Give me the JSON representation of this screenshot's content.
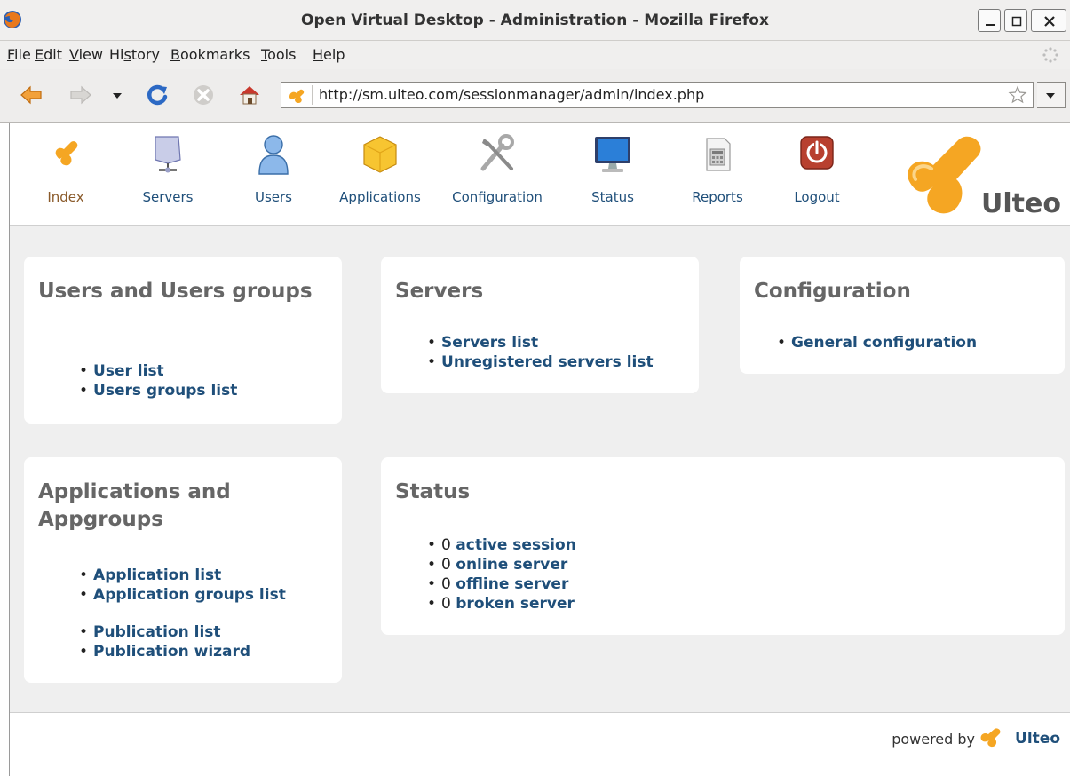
{
  "window": {
    "title": "Open Virtual Desktop - Administration - Mozilla Firefox"
  },
  "menu": {
    "items": [
      {
        "label": "File",
        "u": "F",
        "rest": "ile"
      },
      {
        "label": "Edit",
        "u": "E",
        "rest": "dit"
      },
      {
        "label": "View",
        "u": "V",
        "rest": "iew"
      },
      {
        "label": "History",
        "pre": "Hi",
        "u": "s",
        "rest": "tory"
      },
      {
        "label": "Bookmarks",
        "u": "B",
        "rest": "ookmarks"
      },
      {
        "label": "Tools",
        "u": "T",
        "rest": "ools"
      },
      {
        "label": "Help",
        "u": "H",
        "rest": "elp"
      }
    ]
  },
  "toolbar": {
    "url": "http://sm.ulteo.com/sessionmanager/admin/index.php"
  },
  "nav": {
    "items": [
      {
        "label": "Index",
        "icon": "ulteo-index-icon"
      },
      {
        "label": "Servers",
        "icon": "servers-icon"
      },
      {
        "label": "Users",
        "icon": "users-icon"
      },
      {
        "label": "Applications",
        "icon": "applications-icon"
      },
      {
        "label": "Configuration",
        "icon": "configuration-icon"
      },
      {
        "label": "Status",
        "icon": "status-monitor-icon"
      },
      {
        "label": "Reports",
        "icon": "reports-icon"
      },
      {
        "label": "Logout",
        "icon": "logout-icon"
      }
    ],
    "brand": "Ulteo"
  },
  "cards": {
    "users": {
      "title": "Users and Users groups",
      "links": [
        "User list",
        "Users groups list"
      ]
    },
    "servers": {
      "title": "Servers",
      "links": [
        "Servers list",
        "Unregistered servers list"
      ]
    },
    "configuration": {
      "title": "Configuration",
      "links": [
        "General configuration"
      ]
    },
    "applications": {
      "title": "Applications and Appgroups",
      "links": [
        "Application list",
        "Application groups list"
      ],
      "links2": [
        "Publication list",
        "Publication wizard"
      ]
    },
    "status": {
      "title": "Status",
      "items": [
        {
          "count": "0",
          "label": "active session"
        },
        {
          "count": "0",
          "label": "online server"
        },
        {
          "count": "0",
          "label": "offline server"
        },
        {
          "count": "0",
          "label": "broken server"
        }
      ]
    }
  },
  "footer": {
    "powered_by": "powered by",
    "brand": "Ulteo"
  },
  "colors": {
    "link": "#1f4f7a",
    "heading": "#666666",
    "content_bg": "#efefef",
    "ulteo_orange": "#f5a623"
  }
}
